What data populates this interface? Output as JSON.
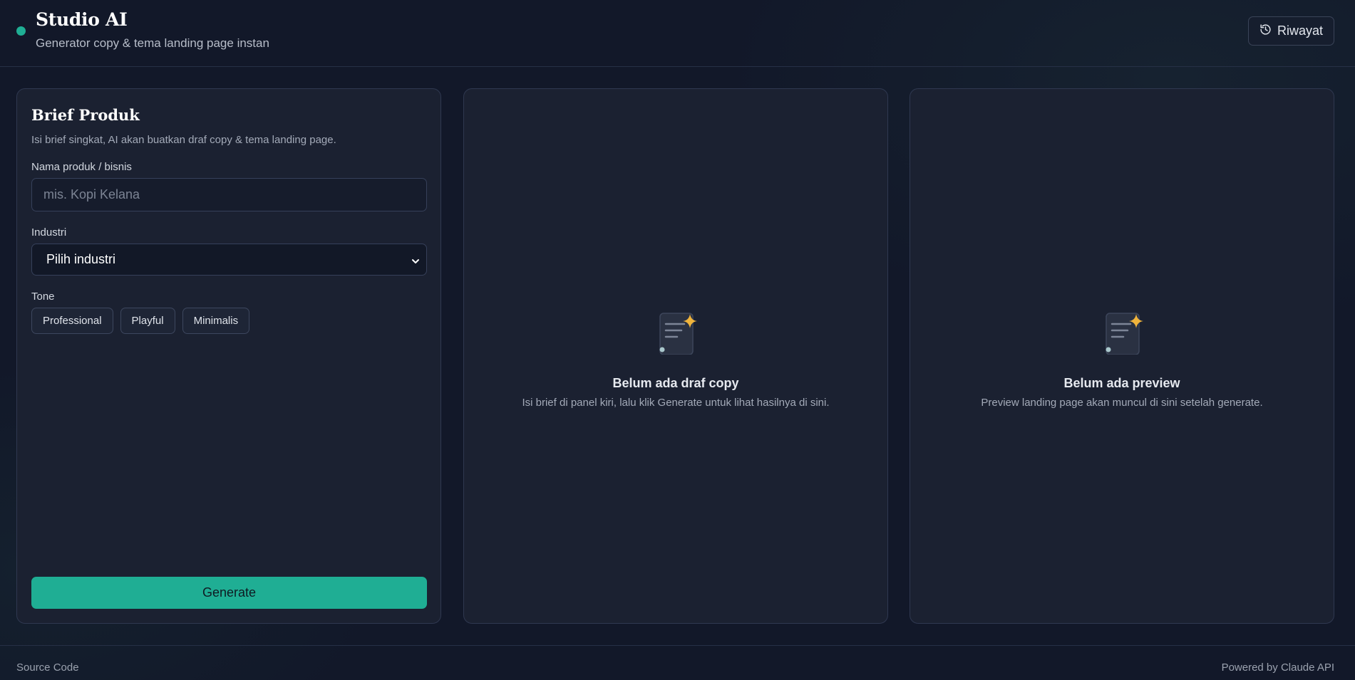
{
  "header": {
    "title": "Studio AI",
    "subtitle": "Generator copy & tema landing page instan",
    "history_label": "Riwayat",
    "history_icon": "history-icon",
    "status_color": "#1fae94"
  },
  "brief": {
    "title": "Brief Produk",
    "description": "Isi brief singkat, AI akan buatkan draf copy & tema landing page.",
    "name_label": "Nama produk / bisnis",
    "name_value": "",
    "name_placeholder": "mis. Kopi Kelana",
    "industry_label": "Industri",
    "industry_selected": "Pilih industri",
    "tone_label": "Tone",
    "tones": [
      "Professional",
      "Playful",
      "Minimalis"
    ],
    "generate_label": "Generate",
    "accent_color": "#1fae94"
  },
  "copy_panel": {
    "empty_icon": "document-sparkle-icon",
    "empty_title": "Belum ada draf copy",
    "empty_desc": "Isi brief di panel kiri, lalu klik Generate untuk lihat hasilnya di sini."
  },
  "preview_panel": {
    "empty_icon": "document-sparkle-icon",
    "empty_title": "Belum ada preview",
    "empty_desc": "Preview landing page akan muncul di sini setelah generate."
  },
  "footer": {
    "source_label": "Source Code",
    "powered_label": "Powered by Claude API"
  }
}
